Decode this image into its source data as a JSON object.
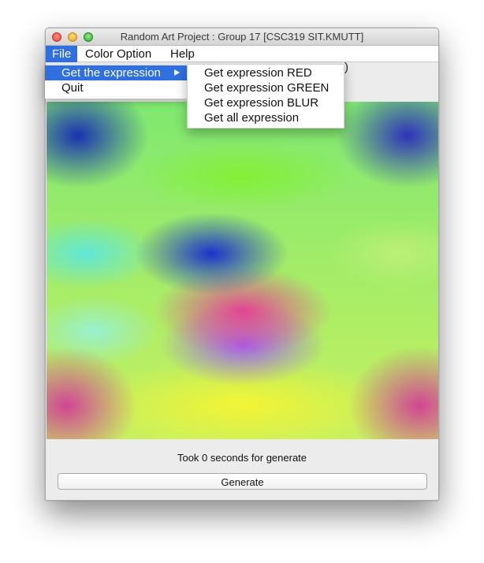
{
  "window": {
    "title": "Random Art Project : Group 17 [CSC319 SIT.KMUTT]"
  },
  "menubar": {
    "items": [
      {
        "label": "File",
        "active": true
      },
      {
        "label": "Color Option",
        "active": false
      },
      {
        "label": "Help",
        "active": false
      }
    ]
  },
  "file_menu": {
    "items": [
      {
        "label": "Get the expression",
        "has_submenu": true,
        "highlighted": true
      },
      {
        "label": "Quit",
        "has_submenu": false,
        "highlighted": false
      }
    ]
  },
  "expression_submenu": {
    "items": [
      {
        "label": "Get expression RED"
      },
      {
        "label": "Get expression GREEN"
      },
      {
        "label": "Get expression BLUR"
      },
      {
        "label": "Get all expression"
      }
    ]
  },
  "hidden_text_peek": ")",
  "footer": {
    "status_text": "Took 0 seconds for generate",
    "generate_label": "Generate"
  },
  "colors": {
    "highlight": "#2f6fe0",
    "window_bg": "#ececec"
  }
}
